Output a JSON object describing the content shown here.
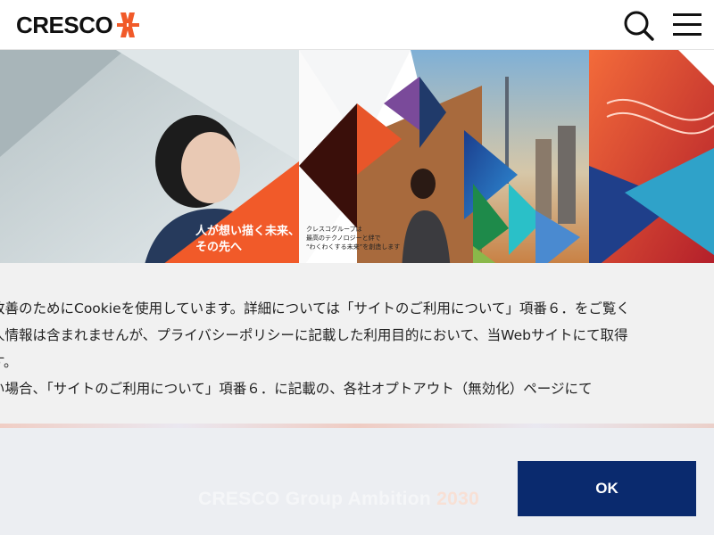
{
  "header": {
    "logo_text": "CRESCO",
    "search_icon": "search-icon",
    "menu_icon": "hamburger-menu-icon"
  },
  "hero": {
    "left_caption_line1": "人が想い描く未来、",
    "left_caption_line2": "その先へ",
    "center_caption_line1": "クレスコグループは",
    "center_caption_line2": "最高のテクノロジーと絆で",
    "center_caption_line3": "“わくわくする未来”を創造します"
  },
  "cookie": {
    "line1": "改善のためにCookieを使用しています。詳細については「サイトのご利用について」項番６．をご覧く",
    "line2": "人情報は含まれませんが、プライバシーポリシーに記載した利用目的において、当Webサイトにて取得",
    "line3": "す。",
    "line4": "い場合、「サイトのご利用について」項番６．に記載の、各社オプトアウト（無効化）ページにて",
    "ok_label": "OK"
  },
  "banner": {
    "title": "CRESCO Group Ambition",
    "year": "2030"
  },
  "colors": {
    "accent_orange": "#f15a29",
    "ok_button": "#0a2a6e",
    "cookie_bg": "#f1f1f1"
  }
}
